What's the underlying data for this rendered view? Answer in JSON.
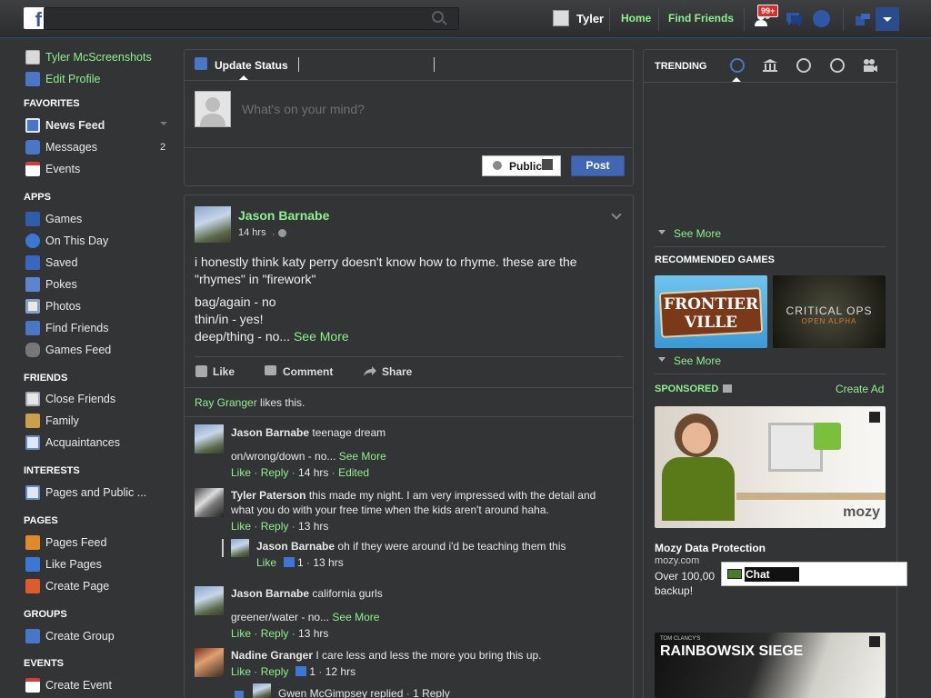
{
  "topbar": {
    "user_name": "Tyler",
    "home": "Home",
    "find_friends": "Find Friends",
    "friend_requests_badge": "99+"
  },
  "sidebar": {
    "profile_name": "Tyler McScreenshots",
    "edit_profile": "Edit Profile",
    "favorites_header": "FAVORITES",
    "favorites": [
      {
        "label": "News Feed",
        "icon": "news-feed-icon"
      },
      {
        "label": "Messages",
        "icon": "messages-icon",
        "count": "2"
      },
      {
        "label": "Events",
        "icon": "calendar-icon"
      }
    ],
    "apps_header": "APPS",
    "apps": [
      {
        "label": "Games",
        "icon": "games-icon"
      },
      {
        "label": "On This Day",
        "icon": "clock-icon"
      },
      {
        "label": "Saved",
        "icon": "bookmark-icon"
      },
      {
        "label": "Pokes",
        "icon": "poke-icon"
      },
      {
        "label": "Photos",
        "icon": "photos-icon"
      },
      {
        "label": "Find Friends",
        "icon": "find-friends-icon"
      },
      {
        "label": "Games Feed",
        "icon": "gamepad-icon"
      }
    ],
    "friends_header": "FRIENDS",
    "friends": [
      {
        "label": "Close Friends",
        "icon": "star-list-icon"
      },
      {
        "label": "Family",
        "icon": "house-icon"
      },
      {
        "label": "Acquaintances",
        "icon": "people-list-icon"
      }
    ],
    "interests_header": "INTERESTS",
    "interests": [
      {
        "label": "Pages and Public ...",
        "icon": "rss-icon"
      }
    ],
    "pages_header": "PAGES",
    "pages": [
      {
        "label": "Pages Feed",
        "icon": "flag-icon"
      },
      {
        "label": "Like Pages",
        "icon": "thumb-icon"
      },
      {
        "label": "Create Page",
        "icon": "plus-icon"
      }
    ],
    "groups_header": "GROUPS",
    "groups": [
      {
        "label": "Create Group",
        "icon": "plus-icon"
      }
    ],
    "events_header": "EVENTS",
    "events": [
      {
        "label": "Create Event",
        "icon": "plus-icon"
      }
    ]
  },
  "composer": {
    "tab": "Update Status",
    "placeholder": "What's on your mind?",
    "audience": "Public",
    "post": "Post"
  },
  "post": {
    "author": "Jason Barnabe",
    "time": "14 hrs",
    "text_1": "i honestly think katy perry doesn't know how to rhyme. these are the",
    "text_2": "\"rhymes\" in \"firework\"",
    "line_1": "bag/again - no",
    "line_2": "thin/in - yes!",
    "line_3": "deep/thing - no...",
    "see_more": "See More",
    "like": "Like",
    "comment": "Comment",
    "share": "Share",
    "liker": "Ray Granger",
    "likes_suffix": "likes this."
  },
  "comments": [
    {
      "author": "Jason Barnabe",
      "text": "teenage dream",
      "extra": "on/wrong/down - no...",
      "see_more": "See More",
      "like": "Like",
      "reply": "Reply",
      "time": "14 hrs",
      "edited": "Edited"
    },
    {
      "author": "Tyler Paterson",
      "text_1": "this made my night. I am very impressed with the detail and",
      "text_2": "what you do with your free time when the kids aren't around haha.",
      "like": "Like",
      "reply": "Reply",
      "time": "13 hrs"
    },
    {
      "author": "Jason Barnabe",
      "text": "oh if they were around i'd be teaching them this",
      "like": "Like",
      "likes": "1",
      "time": "13 hrs"
    },
    {
      "author": "Jason Barnabe",
      "text": "california gurls",
      "extra": "greener/water - no...",
      "see_more": "See More",
      "like": "Like",
      "reply": "Reply",
      "time": "13 hrs"
    },
    {
      "author": "Nadine Granger",
      "text": "I care less and less the more you bring this up.",
      "like": "Like",
      "reply": "Reply",
      "likes": "1",
      "time": "12 hrs"
    },
    {
      "reply_author": "Gwen McGimpsey",
      "text": "replied",
      "replies": "1 Reply"
    }
  ],
  "right": {
    "trending": "TRENDING",
    "see_more_1": "See More",
    "recommended_games": "RECOMMENDED GAMES",
    "game_1_line1": "FRONTIER",
    "game_1_line2": "VILLE",
    "game_2_line1": "CRITICAL OPS",
    "game_2_line2": "OPEN ALPHA",
    "see_more_2": "See More",
    "sponsored": "SPONSORED",
    "create_ad": "Create Ad",
    "ad_brand": "mozy",
    "ad_title": "Mozy Data Protection",
    "ad_url": "mozy.com",
    "ad_text_1": "Over 100,00",
    "ad_text_2": "backup!",
    "ad2_text": "RAINBOWSIX SIEGE",
    "ad2_top": "TOM CLANCY'S",
    "chat": "Chat"
  }
}
